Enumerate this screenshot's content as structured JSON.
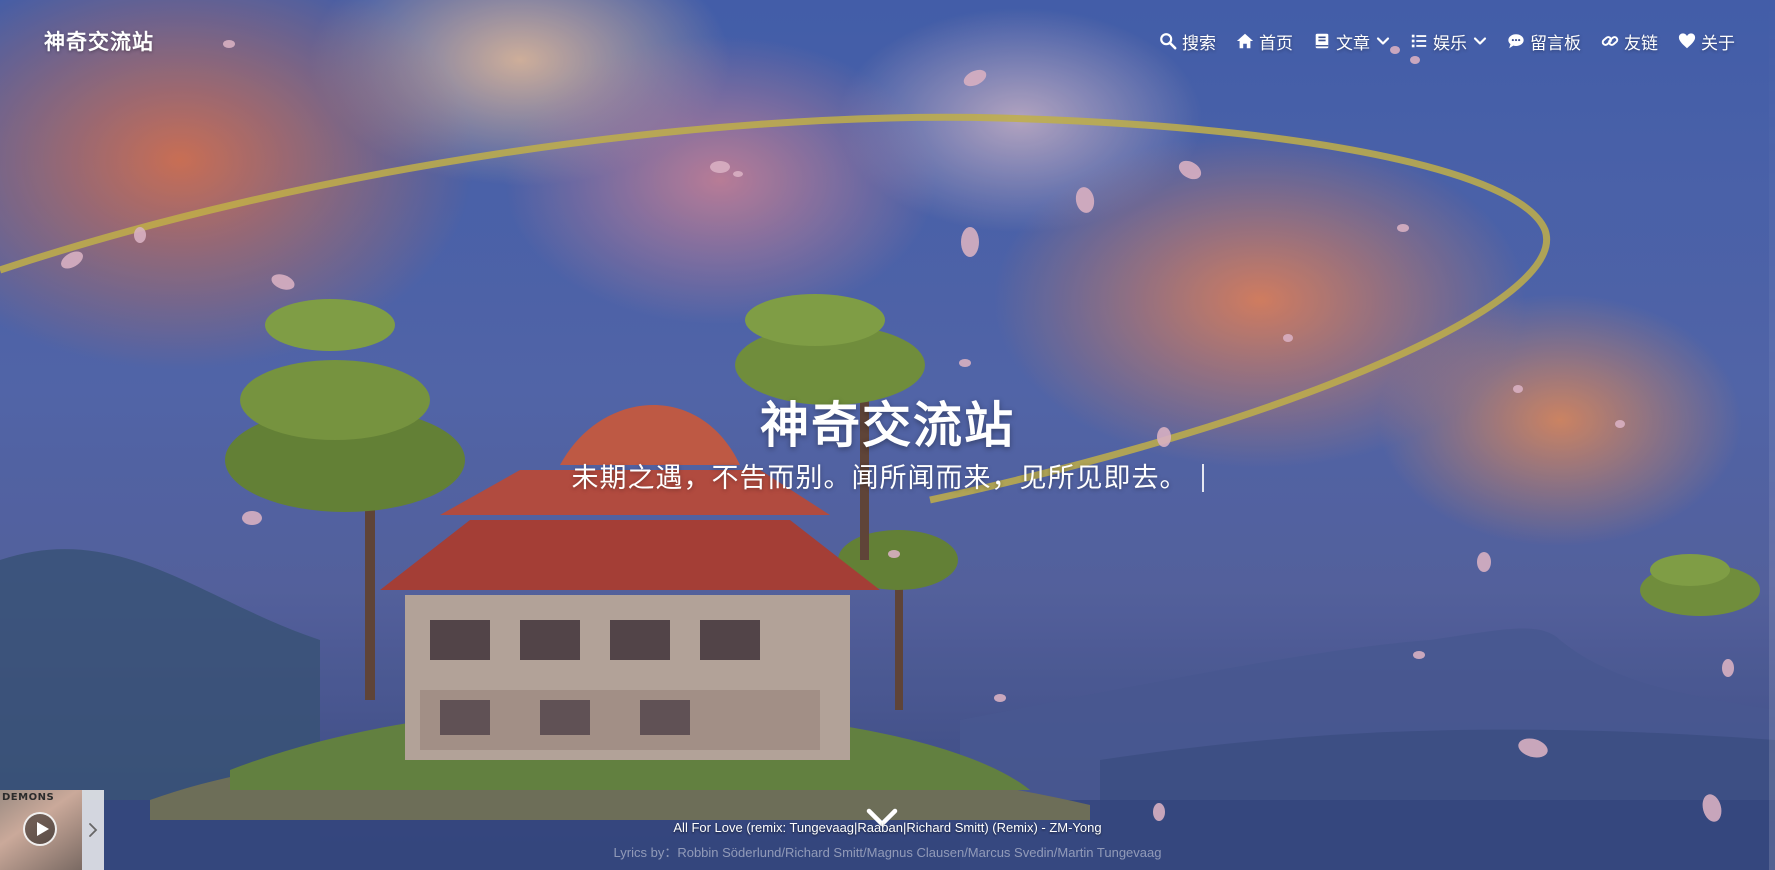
{
  "site": {
    "brand": "神奇交流站"
  },
  "nav": {
    "items": [
      {
        "label": "搜索",
        "icon": "search-icon"
      },
      {
        "label": "首页",
        "icon": "home-icon"
      },
      {
        "label": "文章",
        "icon": "book-icon",
        "dropdown": true
      },
      {
        "label": "娱乐",
        "icon": "list-icon",
        "dropdown": true
      },
      {
        "label": "留言板",
        "icon": "comment-icon"
      },
      {
        "label": "友链",
        "icon": "link-icon"
      },
      {
        "label": "关于",
        "icon": "heart-icon"
      }
    ]
  },
  "hero": {
    "title": "神奇交流站",
    "subtitle": "未期之遇，不告而别。闻所闻而来，见所见即去。"
  },
  "player": {
    "cover_text": "DEMONS",
    "current_lyric": "All For Love (remix: Tungevaag|Raaban|Richard Smitt) (Remix) - ZM-Yong",
    "next_lyric": "Lyrics by：Robbin Söderlund/Richard Smitt/Magnus Clausen/Marcus Svedin/Martin Tungevaag"
  },
  "colors": {
    "sky": "#4a67b5",
    "cloud_orange": "#e27a56",
    "text": "#ffffff",
    "golden_trail": "#d8c449"
  }
}
